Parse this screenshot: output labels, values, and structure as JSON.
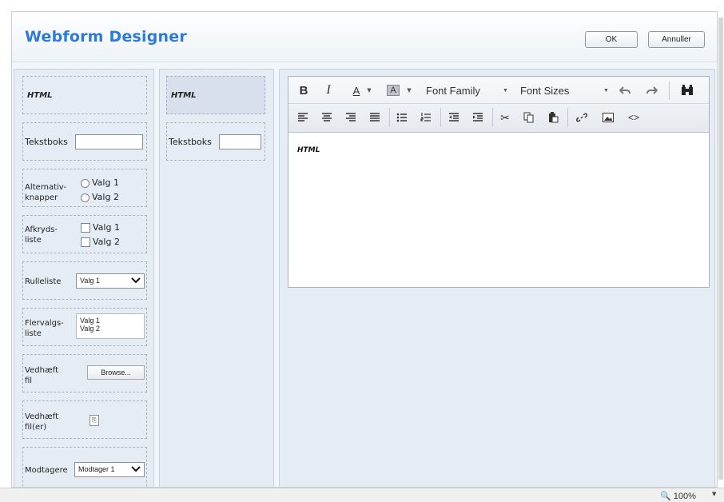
{
  "dialog": {
    "title": "Webform Designer",
    "ok_label": "OK",
    "cancel_label": "Annuller"
  },
  "palette": {
    "html_label": "HTML",
    "textbox_label": "Tekstboks",
    "radio": {
      "label": "Alternativ-knapper",
      "options": [
        "Valg 1",
        "Valg 2"
      ]
    },
    "checklist": {
      "label": "Afkryds-liste",
      "options": [
        "Valg 1",
        "Valg 2"
      ]
    },
    "dropdown": {
      "label": "Rulleliste",
      "selected": "Valg 1"
    },
    "multiselect": {
      "label": "Flervalgs-liste",
      "options": [
        "Valg 1",
        "Valg 2"
      ]
    },
    "attach_file": {
      "label": "Vedhæft fil",
      "browse_label": "Browse..."
    },
    "attach_files": {
      "label": "Vedhæft fil(er)"
    },
    "recipients": {
      "label": "Modtagere",
      "selected": "Modtager 1"
    }
  },
  "form": {
    "html_label": "HTML",
    "textbox_label": "Tekstboks"
  },
  "editor": {
    "toolbar": {
      "bold": "B",
      "italic": "I",
      "font_color": "A",
      "highlight_color": "A",
      "font_family": "Font Family",
      "font_sizes": "Font Sizes"
    },
    "content": "HTML"
  },
  "statusbar": {
    "zoom": "100%"
  },
  "colors": {
    "accent": "#2f7ad6",
    "panel": "#e6ecf4"
  }
}
